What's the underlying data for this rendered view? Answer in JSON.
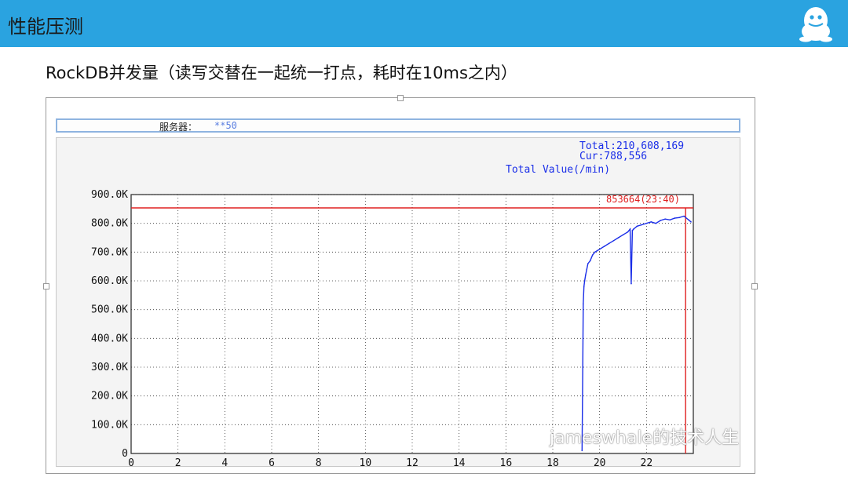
{
  "header": {
    "title": "性能压测",
    "logo_icon": "penguin-icon",
    "bg_color": "#2aa3e0"
  },
  "slide": {
    "subtitle": "RockDB并发量（读写交替在一起统一打点，耗时在10ms之内）"
  },
  "panel": {
    "server_label": "服务器：",
    "server_value": "**50"
  },
  "stats": {
    "total": "Total:210,608,169",
    "cur": "Cur:788,556",
    "value_label": "Total Value(/min)",
    "peak_annotation": "853664(23:40)"
  },
  "watermark": "jameswhale的技术人生",
  "chart_data": {
    "type": "line",
    "title": "",
    "xlabel": "",
    "ylabel": "",
    "x_ticks": [
      "0",
      "2",
      "4",
      "6",
      "8",
      "10",
      "12",
      "14",
      "16",
      "18",
      "20",
      "22"
    ],
    "y_ticks": [
      "0",
      "100.0K",
      "200.0K",
      "300.0K",
      "400.0K",
      "500.0K",
      "600.0K",
      "700.0K",
      "800.0K",
      "900.0K"
    ],
    "xlim": [
      0,
      24
    ],
    "ylim": [
      0,
      900000
    ],
    "grid": true,
    "peak_line": 853664,
    "peak_time": 23.67,
    "line_color": "#1a2ee8",
    "peak_color": "#e02020",
    "series": [
      {
        "x": [
          19.25,
          19.28,
          19.3,
          19.33,
          19.36,
          19.4,
          19.45,
          19.5,
          19.6,
          19.7,
          19.8,
          19.9,
          20.0,
          20.2,
          20.4,
          20.6,
          20.8,
          21.0,
          21.2,
          21.3,
          21.35,
          21.4,
          21.45,
          21.6,
          21.8,
          22.0,
          22.2,
          22.4,
          22.6,
          22.8,
          23.0,
          23.2,
          23.4,
          23.6,
          23.8,
          23.9
        ],
        "y": [
          10000,
          300000,
          520000,
          580000,
          600000,
          620000,
          640000,
          660000,
          670000,
          690000,
          700000,
          705000,
          710000,
          720000,
          730000,
          740000,
          750000,
          760000,
          770000,
          780000,
          590000,
          775000,
          780000,
          790000,
          795000,
          800000,
          805000,
          800000,
          810000,
          815000,
          812000,
          818000,
          820000,
          825000,
          812000,
          805000
        ]
      }
    ]
  }
}
